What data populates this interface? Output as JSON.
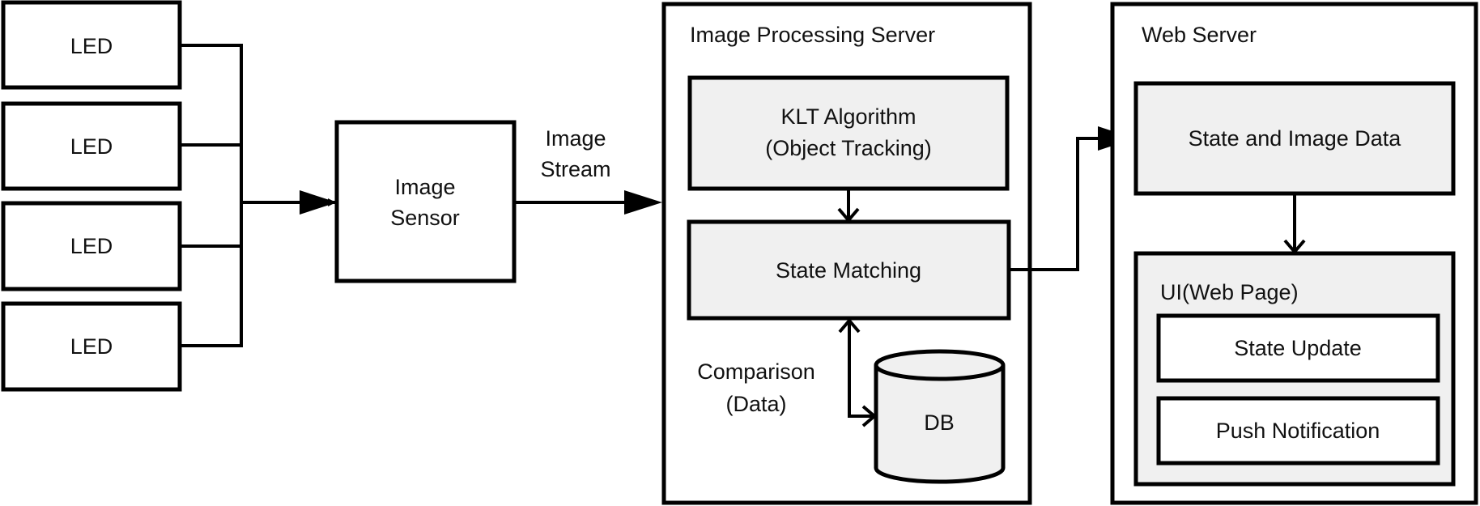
{
  "leds": [
    "LED",
    "LED",
    "LED",
    "LED"
  ],
  "image_sensor": {
    "line1": "Image",
    "line2": "Sensor"
  },
  "stream_label": {
    "line1": "Image",
    "line2": "Stream"
  },
  "image_processing_server": {
    "title": "Image Processing Server",
    "klt": {
      "line1": "KLT Algorithm",
      "line2": "(Object Tracking)"
    },
    "state_matching": "State Matching",
    "comparison": {
      "line1": "Comparison",
      "line2": "(Data)"
    },
    "db": "DB"
  },
  "web_server": {
    "title": "Web Server",
    "state_image_data": "State and Image Data",
    "ui": {
      "title": "UI(Web Page)",
      "state_update": "State Update",
      "push_notification": "Push Notification"
    }
  },
  "colors": {
    "module_fill": "#f0f0f0",
    "stroke": "#000000"
  }
}
